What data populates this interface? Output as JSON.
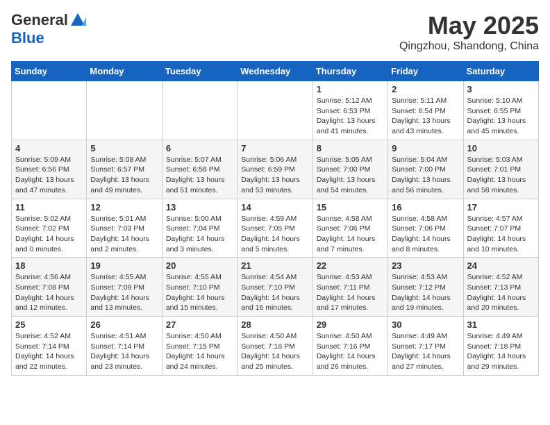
{
  "header": {
    "logo_general": "General",
    "logo_blue": "Blue",
    "month": "May 2025",
    "location": "Qingzhou, Shandong, China"
  },
  "weekdays": [
    "Sunday",
    "Monday",
    "Tuesday",
    "Wednesday",
    "Thursday",
    "Friday",
    "Saturday"
  ],
  "weeks": [
    [
      {
        "day": "",
        "info": ""
      },
      {
        "day": "",
        "info": ""
      },
      {
        "day": "",
        "info": ""
      },
      {
        "day": "",
        "info": ""
      },
      {
        "day": "1",
        "info": "Sunrise: 5:12 AM\nSunset: 6:53 PM\nDaylight: 13 hours\nand 41 minutes."
      },
      {
        "day": "2",
        "info": "Sunrise: 5:11 AM\nSunset: 6:54 PM\nDaylight: 13 hours\nand 43 minutes."
      },
      {
        "day": "3",
        "info": "Sunrise: 5:10 AM\nSunset: 6:55 PM\nDaylight: 13 hours\nand 45 minutes."
      }
    ],
    [
      {
        "day": "4",
        "info": "Sunrise: 5:09 AM\nSunset: 6:56 PM\nDaylight: 13 hours\nand 47 minutes."
      },
      {
        "day": "5",
        "info": "Sunrise: 5:08 AM\nSunset: 6:57 PM\nDaylight: 13 hours\nand 49 minutes."
      },
      {
        "day": "6",
        "info": "Sunrise: 5:07 AM\nSunset: 6:58 PM\nDaylight: 13 hours\nand 51 minutes."
      },
      {
        "day": "7",
        "info": "Sunrise: 5:06 AM\nSunset: 6:59 PM\nDaylight: 13 hours\nand 53 minutes."
      },
      {
        "day": "8",
        "info": "Sunrise: 5:05 AM\nSunset: 7:00 PM\nDaylight: 13 hours\nand 54 minutes."
      },
      {
        "day": "9",
        "info": "Sunrise: 5:04 AM\nSunset: 7:00 PM\nDaylight: 13 hours\nand 56 minutes."
      },
      {
        "day": "10",
        "info": "Sunrise: 5:03 AM\nSunset: 7:01 PM\nDaylight: 13 hours\nand 58 minutes."
      }
    ],
    [
      {
        "day": "11",
        "info": "Sunrise: 5:02 AM\nSunset: 7:02 PM\nDaylight: 14 hours\nand 0 minutes."
      },
      {
        "day": "12",
        "info": "Sunrise: 5:01 AM\nSunset: 7:03 PM\nDaylight: 14 hours\nand 2 minutes."
      },
      {
        "day": "13",
        "info": "Sunrise: 5:00 AM\nSunset: 7:04 PM\nDaylight: 14 hours\nand 3 minutes."
      },
      {
        "day": "14",
        "info": "Sunrise: 4:59 AM\nSunset: 7:05 PM\nDaylight: 14 hours\nand 5 minutes."
      },
      {
        "day": "15",
        "info": "Sunrise: 4:58 AM\nSunset: 7:06 PM\nDaylight: 14 hours\nand 7 minutes."
      },
      {
        "day": "16",
        "info": "Sunrise: 4:58 AM\nSunset: 7:06 PM\nDaylight: 14 hours\nand 8 minutes."
      },
      {
        "day": "17",
        "info": "Sunrise: 4:57 AM\nSunset: 7:07 PM\nDaylight: 14 hours\nand 10 minutes."
      }
    ],
    [
      {
        "day": "18",
        "info": "Sunrise: 4:56 AM\nSunset: 7:08 PM\nDaylight: 14 hours\nand 12 minutes."
      },
      {
        "day": "19",
        "info": "Sunrise: 4:55 AM\nSunset: 7:09 PM\nDaylight: 14 hours\nand 13 minutes."
      },
      {
        "day": "20",
        "info": "Sunrise: 4:55 AM\nSunset: 7:10 PM\nDaylight: 14 hours\nand 15 minutes."
      },
      {
        "day": "21",
        "info": "Sunrise: 4:54 AM\nSunset: 7:10 PM\nDaylight: 14 hours\nand 16 minutes."
      },
      {
        "day": "22",
        "info": "Sunrise: 4:53 AM\nSunset: 7:11 PM\nDaylight: 14 hours\nand 17 minutes."
      },
      {
        "day": "23",
        "info": "Sunrise: 4:53 AM\nSunset: 7:12 PM\nDaylight: 14 hours\nand 19 minutes."
      },
      {
        "day": "24",
        "info": "Sunrise: 4:52 AM\nSunset: 7:13 PM\nDaylight: 14 hours\nand 20 minutes."
      }
    ],
    [
      {
        "day": "25",
        "info": "Sunrise: 4:52 AM\nSunset: 7:14 PM\nDaylight: 14 hours\nand 22 minutes."
      },
      {
        "day": "26",
        "info": "Sunrise: 4:51 AM\nSunset: 7:14 PM\nDaylight: 14 hours\nand 23 minutes."
      },
      {
        "day": "27",
        "info": "Sunrise: 4:50 AM\nSunset: 7:15 PM\nDaylight: 14 hours\nand 24 minutes."
      },
      {
        "day": "28",
        "info": "Sunrise: 4:50 AM\nSunset: 7:16 PM\nDaylight: 14 hours\nand 25 minutes."
      },
      {
        "day": "29",
        "info": "Sunrise: 4:50 AM\nSunset: 7:16 PM\nDaylight: 14 hours\nand 26 minutes."
      },
      {
        "day": "30",
        "info": "Sunrise: 4:49 AM\nSunset: 7:17 PM\nDaylight: 14 hours\nand 27 minutes."
      },
      {
        "day": "31",
        "info": "Sunrise: 4:49 AM\nSunset: 7:18 PM\nDaylight: 14 hours\nand 29 minutes."
      }
    ]
  ]
}
